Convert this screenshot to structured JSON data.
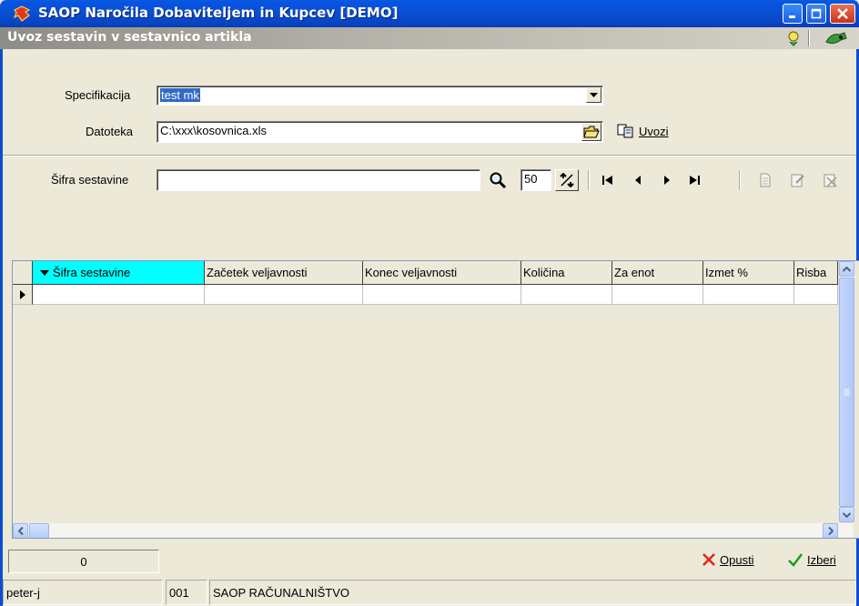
{
  "window": {
    "title": "SAOP  Naročila Dobaviteljem in Kupcev [DEMO]",
    "subtitle": "Uvoz sestavin v sestavnico artikla"
  },
  "form": {
    "spec_label": "Specifikacija",
    "spec_value": "test mk",
    "file_label": "Datoteka",
    "file_value": "C:\\xxx\\kosovnica.xls",
    "import_label": "Uvozi"
  },
  "toolbar": {
    "search_label": "Šifra sestavine",
    "search_value": "",
    "page_size": "50"
  },
  "grid": {
    "columns": [
      "Šifra sestavine",
      "Začetek veljavnosti",
      "Konec veljavnosti",
      "Količina",
      "Za enot",
      "Izmet %",
      "Risba"
    ],
    "rows": [
      [
        "",
        "",
        "",
        "",
        "",
        "",
        ""
      ]
    ]
  },
  "footer": {
    "count": "0",
    "cancel_label": "Opusti",
    "select_label": "Izberi"
  },
  "status": {
    "user": "peter-j",
    "company_code": "001",
    "company_name": "SAOP RAČUNALNIŠTVO"
  },
  "colors": {
    "titlebar": "#0a4fd0",
    "selection": "#316ac5",
    "sort_header": "#00ffff"
  }
}
